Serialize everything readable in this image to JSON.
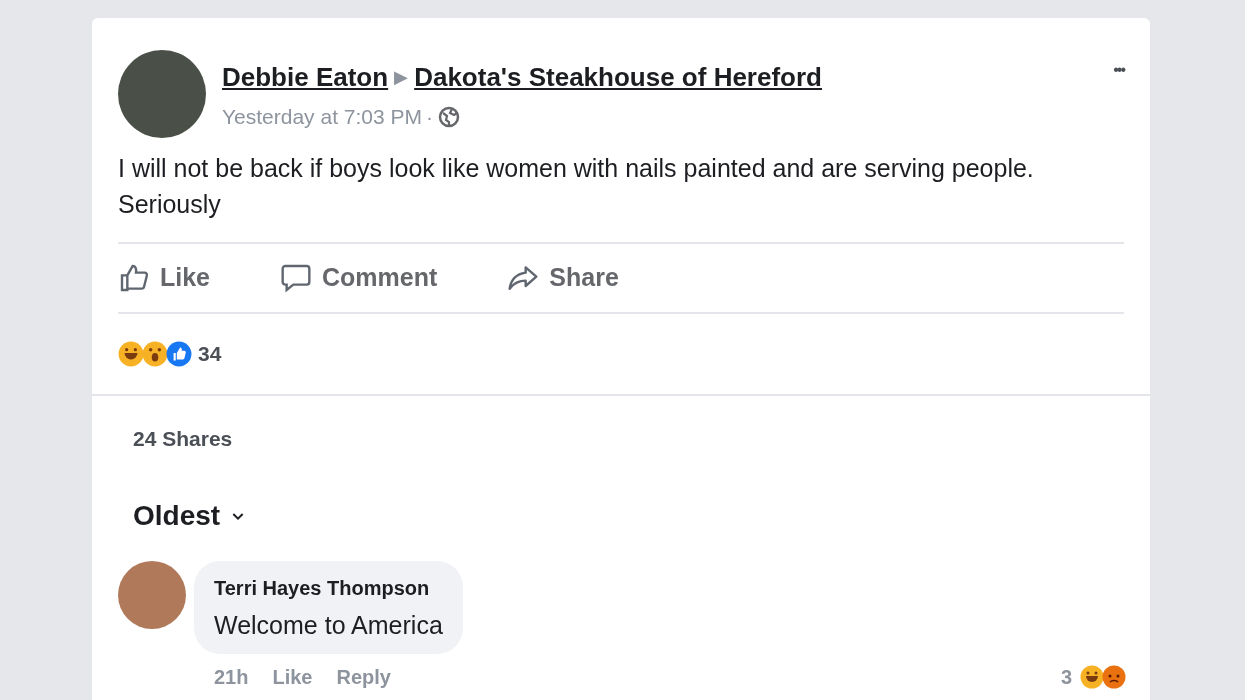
{
  "post": {
    "author": "Debbie Eaton",
    "separator": "▶",
    "target": "Dakota's Steakhouse of Hereford",
    "timestamp": "Yesterday at 7:03 PM",
    "dot": "·",
    "more": "•••",
    "text": "I will not be back if boys look like women with nails painted and are serving people. Seriously"
  },
  "actions": [
    {
      "kind": "like",
      "label": "Like"
    },
    {
      "kind": "comment",
      "label": "Comment"
    },
    {
      "kind": "share",
      "label": "Share"
    }
  ],
  "reactions": {
    "icons": [
      {
        "kind": "haha"
      },
      {
        "kind": "wow"
      },
      {
        "kind": "like"
      }
    ],
    "count": "34"
  },
  "shares": "24 Shares",
  "sort": {
    "label": "Oldest"
  },
  "comments": [
    {
      "author": "Terri Hayes Thompson",
      "text": "Welcome to America",
      "time": "21h",
      "actions": [
        "Like",
        "Reply"
      ],
      "reaction_count": "3",
      "reactions": [
        {
          "kind": "haha"
        },
        {
          "kind": "angry"
        }
      ]
    }
  ]
}
